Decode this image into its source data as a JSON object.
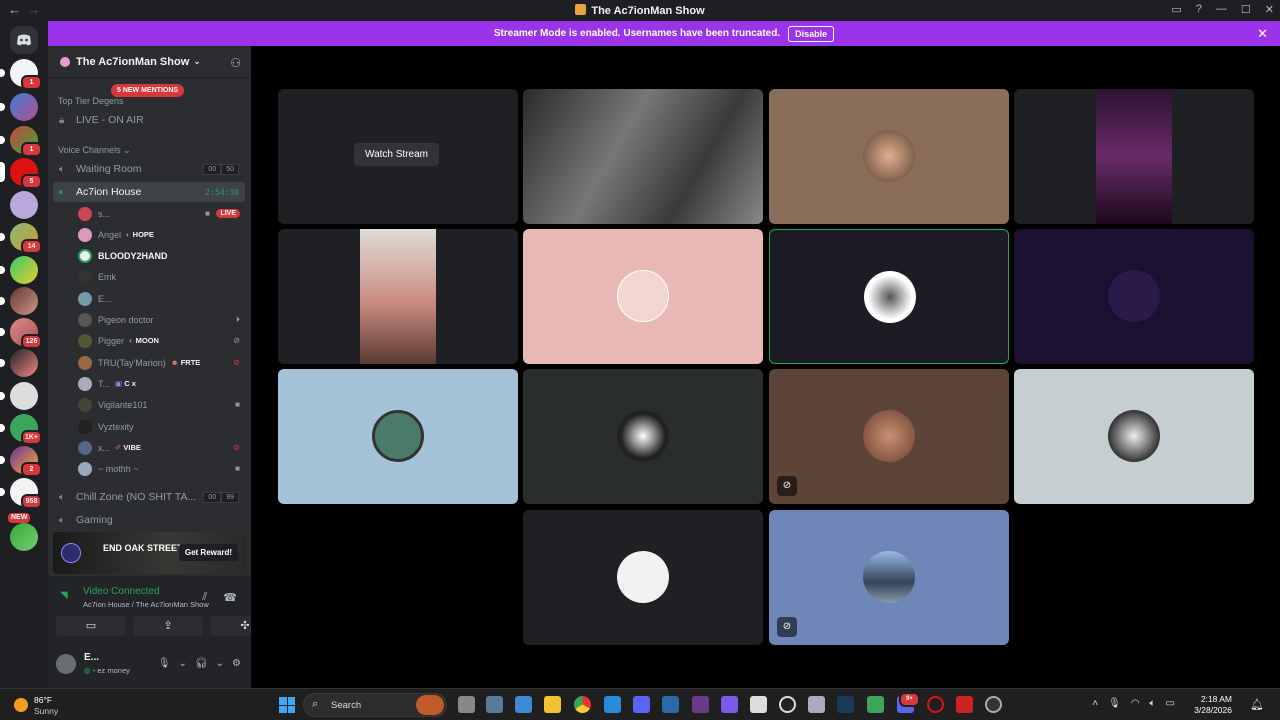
{
  "window": {
    "title": "The Ac7ionMan Show",
    "nav_back": "←",
    "nav_forward": "→",
    "icons": [
      "inbox-icon",
      "help-icon",
      "minimize-icon",
      "maximize-icon",
      "close-icon"
    ]
  },
  "streamer_banner": {
    "text": "Streamer Mode is enabled. Usernames have been truncated.",
    "button": "Disable"
  },
  "guild_badges": [
    "1",
    "1",
    "5",
    "14",
    "126",
    "1K+",
    "2",
    "958",
    "NEW"
  ],
  "server": {
    "name": "The Ac7ionMan Show",
    "mentions_pill": "5 NEW MENTIONS",
    "categories": {
      "top": "Top Tier Degens",
      "voice": "Voice Channels"
    },
    "channels": [
      {
        "name": "LIVE - ON AIR",
        "icon": "lock-icon"
      },
      {
        "name": "Waiting Room",
        "count_a": "00",
        "count_b": "50"
      },
      {
        "name": "Ac7ion House",
        "timer": "2:54:30"
      },
      {
        "name": "Chill Zone (NO SHIT TA...",
        "count_a": "00",
        "count_b": "99"
      },
      {
        "name": "Gaming"
      }
    ],
    "members": [
      {
        "name": "s...",
        "live": "LIVE"
      },
      {
        "name": "Angel",
        "tag": "HOPE"
      },
      {
        "name": "BLOODY2HAND"
      },
      {
        "name": "Emk"
      },
      {
        "name": "E..."
      },
      {
        "name": "Pigeon doctor"
      },
      {
        "name": "Pigger",
        "tag": "MOON"
      },
      {
        "name": "TRU(Tay'Marion)",
        "tag": "FRTE"
      },
      {
        "name": "T...",
        "tag": "C x"
      },
      {
        "name": "Vigilante101"
      },
      {
        "name": "Vyztexity"
      },
      {
        "name": "x...",
        "tag": "VIBE"
      },
      {
        "name": "~ mothh ~"
      }
    ]
  },
  "promo": {
    "logo": "END OAK STREET",
    "button": "Get Reward!"
  },
  "voice_panel": {
    "status": "Video Connected",
    "location": "Ac7ion House / The Ac7ionMan Show"
  },
  "user_panel": {
    "name": "E...",
    "status": "ez money"
  },
  "stage": {
    "watch_stream": "Watch Stream"
  },
  "taskbar": {
    "weather_temp": "86°F",
    "weather_cond": "Sunny",
    "search": "Search",
    "time": "2:18 AM",
    "date": "3/28/2026",
    "discord_badge": "9+"
  },
  "colors": {
    "banner": "#9b33ea",
    "accent_green": "#23a55a",
    "danger": "#da373c",
    "sidebar": "#2b2d31"
  }
}
